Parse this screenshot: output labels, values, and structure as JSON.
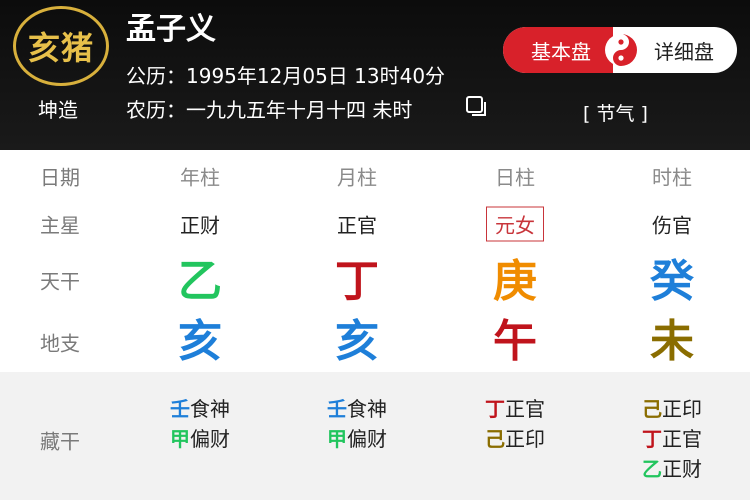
{
  "header": {
    "zodiac": "亥猪",
    "gender": "坤造",
    "name": "孟子义",
    "solar": "公历：1995年12月05日 13时40分",
    "lunar": "农历：一九九五年十月十四 未时",
    "mode_basic": "基本盘",
    "mode_detail": "详细盘",
    "jieqi": "[ 节气 ]"
  },
  "colors": {
    "wood": "#22c55e",
    "fire": "#c0141c",
    "earth_orange": "#f08c00",
    "earth_olive": "#8a6d00",
    "water": "#1e7fd9",
    "accent_red": "#d8212a",
    "badge_gold": "#d8b03c"
  },
  "table": {
    "row_labels": {
      "date": "日期",
      "main_star": "主星",
      "tiangan": "天干",
      "dizhi": "地支",
      "canggan": "藏干"
    },
    "columns": [
      {
        "header": "年柱",
        "main_star": "正财",
        "tiangan": {
          "char": "乙",
          "color": "#22c55e"
        },
        "dizhi": {
          "char": "亥",
          "color": "#1e7fd9"
        },
        "hidden": [
          {
            "stem": "壬",
            "god": "食神",
            "color": "#1e7fd9"
          },
          {
            "stem": "甲",
            "god": "偏财",
            "color": "#22c55e"
          }
        ]
      },
      {
        "header": "月柱",
        "main_star": "正官",
        "tiangan": {
          "char": "丁",
          "color": "#c0141c"
        },
        "dizhi": {
          "char": "亥",
          "color": "#1e7fd9"
        },
        "hidden": [
          {
            "stem": "壬",
            "god": "食神",
            "color": "#1e7fd9"
          },
          {
            "stem": "甲",
            "god": "偏财",
            "color": "#22c55e"
          }
        ]
      },
      {
        "header": "日柱",
        "main_star": "元女",
        "tiangan": {
          "char": "庚",
          "color": "#f08c00"
        },
        "dizhi": {
          "char": "午",
          "color": "#c0141c"
        },
        "hidden": [
          {
            "stem": "丁",
            "god": "正官",
            "color": "#c0141c"
          },
          {
            "stem": "己",
            "god": "正印",
            "color": "#8a6d00"
          }
        ]
      },
      {
        "header": "时柱",
        "main_star": "伤官",
        "tiangan": {
          "char": "癸",
          "color": "#1e7fd9"
        },
        "dizhi": {
          "char": "未",
          "color": "#8a6d00"
        },
        "hidden": [
          {
            "stem": "己",
            "god": "正印",
            "color": "#8a6d00"
          },
          {
            "stem": "丁",
            "god": "正官",
            "color": "#c0141c"
          },
          {
            "stem": "乙",
            "god": "正财",
            "color": "#22c55e"
          }
        ]
      }
    ]
  }
}
